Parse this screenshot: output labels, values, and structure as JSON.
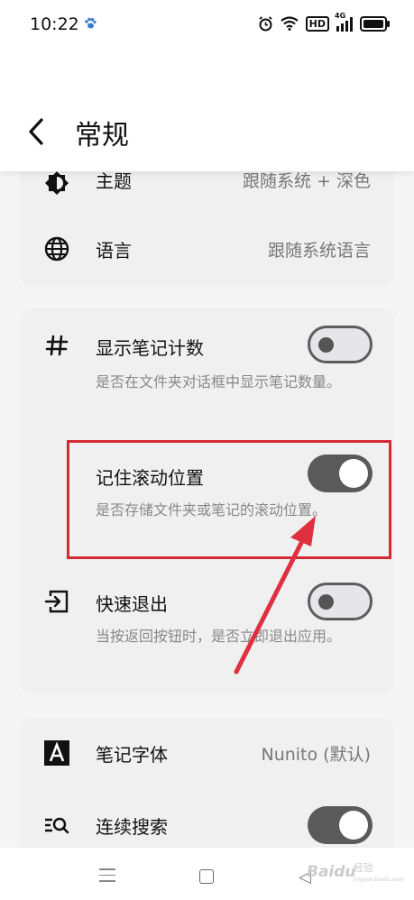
{
  "status": {
    "time": "10:22",
    "network": "4G",
    "hd": "HD"
  },
  "header": {
    "title": "常规"
  },
  "section1": {
    "theme_label": "主题",
    "theme_value": "跟随系统 + 深色",
    "language_label": "语言",
    "language_value": "跟随系统语言"
  },
  "section2": {
    "count_title": "显示笔记计数",
    "count_desc": "是否在文件夹对话框中显示笔记数量。",
    "count_on": false,
    "scroll_title": "记住滚动位置",
    "scroll_desc": "是否存储文件夹或笔记的滚动位置。",
    "scroll_on": true,
    "exit_title": "快速退出",
    "exit_desc": "当按返回按钮时，是否立即退出应用。",
    "exit_on": false
  },
  "section3": {
    "font_label": "笔记字体",
    "font_value": "Nunito (默认)",
    "search_label": "连续搜索",
    "search_on": true
  },
  "watermark": {
    "main": "Baidu",
    "sub": "经验",
    "url": "jingyan.baidu.com"
  },
  "colors": {
    "highlight": "#d42a35",
    "toggle_on": "#5a5a5a"
  }
}
